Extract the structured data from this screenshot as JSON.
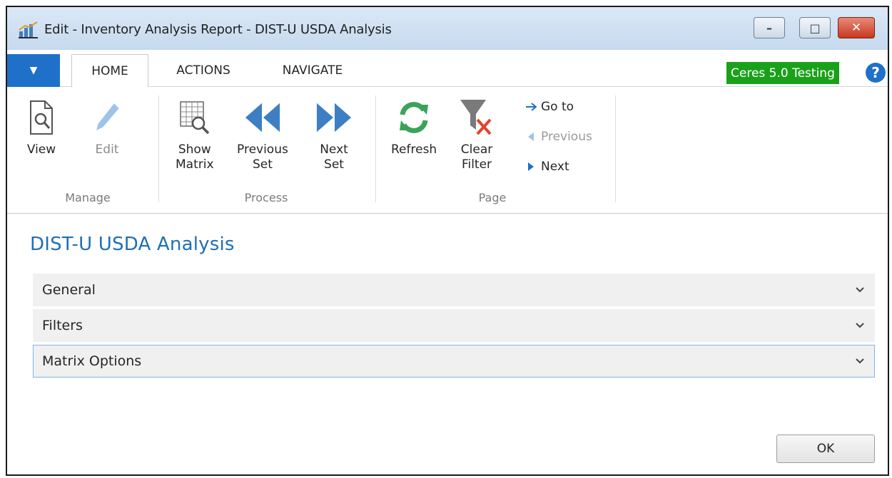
{
  "window": {
    "title": "Edit - Inventory Analysis Report - DIST-U USDA Analysis",
    "controls": {
      "minimize": "–",
      "maximize": "□",
      "close": "✕"
    }
  },
  "tabs": {
    "app_menu": "▼",
    "items": [
      {
        "label": "HOME",
        "active": true
      },
      {
        "label": "ACTIONS",
        "active": false
      },
      {
        "label": "NAVIGATE",
        "active": false
      }
    ],
    "company_badge": "Ceres 5.0 Testing",
    "help_icon": "question-circle-icon"
  },
  "ribbon": {
    "groups": [
      {
        "label": "Manage",
        "buttons": [
          {
            "label": "View",
            "icon": "document-magnifier-icon",
            "enabled": true
          },
          {
            "label": "Edit",
            "icon": "pencil-icon",
            "enabled": false
          }
        ]
      },
      {
        "label": "Process",
        "buttons": [
          {
            "label": "Show\nMatrix",
            "icon": "grid-magnifier-icon",
            "enabled": true
          },
          {
            "label": "Previous\nSet",
            "icon": "double-left-arrow-icon",
            "enabled": true
          },
          {
            "label": "Next\nSet",
            "icon": "double-right-arrow-icon",
            "enabled": true
          }
        ]
      },
      {
        "label": "Page",
        "buttons": [
          {
            "label": "Refresh",
            "icon": "refresh-icon",
            "enabled": true
          },
          {
            "label": "Clear\nFilter",
            "icon": "clear-filter-icon",
            "enabled": true
          }
        ],
        "small_buttons": [
          {
            "label": "Go to",
            "icon": "arrow-right-icon",
            "enabled": true
          },
          {
            "label": "Previous",
            "icon": "triangle-left-icon",
            "enabled": false
          },
          {
            "label": "Next",
            "icon": "triangle-right-icon",
            "enabled": true
          }
        ]
      }
    ]
  },
  "page": {
    "title": "DIST-U USDA Analysis",
    "fasttabs": [
      {
        "label": "General",
        "focused": false
      },
      {
        "label": "Filters",
        "focused": false
      },
      {
        "label": "Matrix Options",
        "focused": true
      }
    ],
    "ok_label": "OK"
  },
  "colors": {
    "accent_blue": "#1f70c9",
    "page_title": "#1f6fb5",
    "badge_green": "#1aa11a",
    "icon_blue": "#3e7fc4",
    "icon_green": "#3aa35a",
    "clear_red": "#e0452b"
  }
}
